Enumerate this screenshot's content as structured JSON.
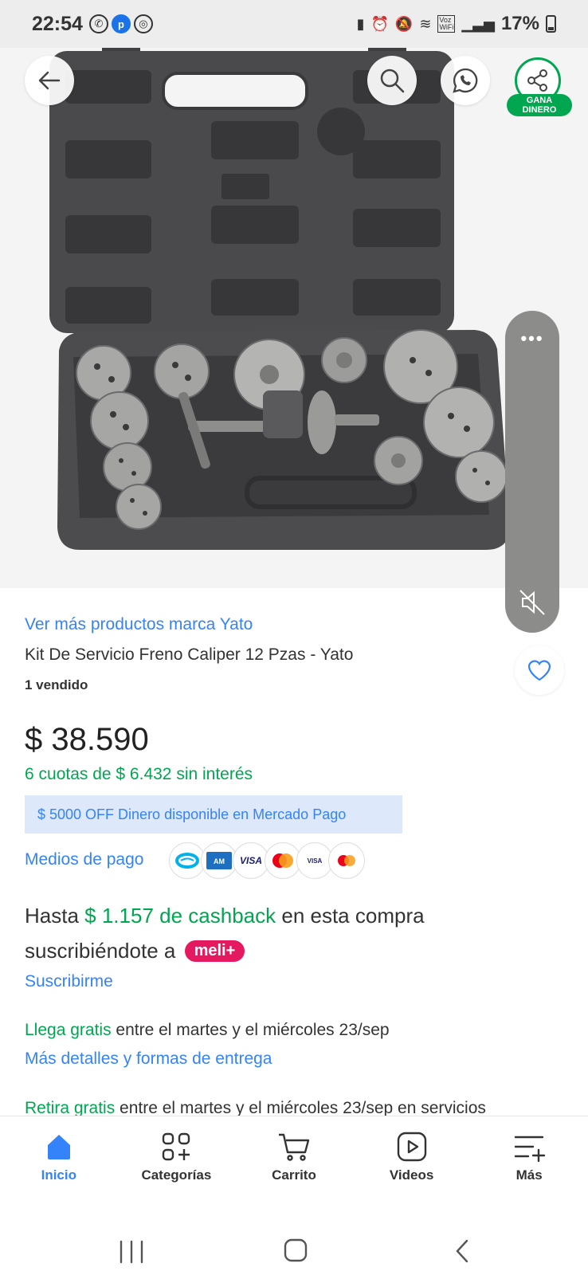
{
  "status_bar": {
    "time": "22:54",
    "battery": "17%",
    "voz_wifi": "Voz\nWiFi"
  },
  "header": {
    "icons": [
      "back-arrow-icon",
      "search-icon",
      "whatsapp-share-icon",
      "share-icon"
    ],
    "share_badge": "GANA\nDINERO"
  },
  "media": {
    "more_dots": "•••",
    "icons": [
      "more-icon",
      "mute-icon"
    ]
  },
  "product": {
    "brand_link": "Ver más productos marca Yato",
    "title": "Kit De Servicio Freno Caliper 12 Pzas - Yato",
    "sold": "1 vendido",
    "price": "$ 38.590",
    "installments": "6 cuotas de $ 6.432 sin interés",
    "promo": "$ 5000 OFF Dinero disponible en Mercado Pago",
    "payment_label": "Medios de pago",
    "payment_methods": [
      "mercado-pago",
      "amex",
      "VISA",
      "mastercard",
      "visa-debit",
      "maestro"
    ]
  },
  "cashback": {
    "prefix": "Hasta",
    "amount": "$ 1.157 de cashback",
    "suffix": "en esta compra",
    "line2": "suscribiéndote a",
    "badge": "meli+",
    "subscribe": "Suscribirme"
  },
  "shipping": {
    "arrive_label": "Llega gratis",
    "arrive_text": "entre el martes y el miércoles 23/sep",
    "details_link": "Más detalles y formas de entrega",
    "pickup_label": "Retira gratis",
    "pickup_text": "entre el martes y el miércoles 23/sep en servicios"
  },
  "bottom_nav": [
    {
      "label": "Inicio",
      "icon": "home-icon",
      "active": true
    },
    {
      "label": "Categorías",
      "icon": "categories-icon",
      "active": false
    },
    {
      "label": "Carrito",
      "icon": "cart-icon",
      "active": false
    },
    {
      "label": "Videos",
      "icon": "video-icon",
      "active": false
    },
    {
      "label": "Más",
      "icon": "menu-icon",
      "active": false
    }
  ],
  "colors": {
    "link_blue": "#3483fa",
    "green": "#00a650",
    "meli_plus": "#e5195f",
    "promo_bg": "#dde8fb"
  }
}
